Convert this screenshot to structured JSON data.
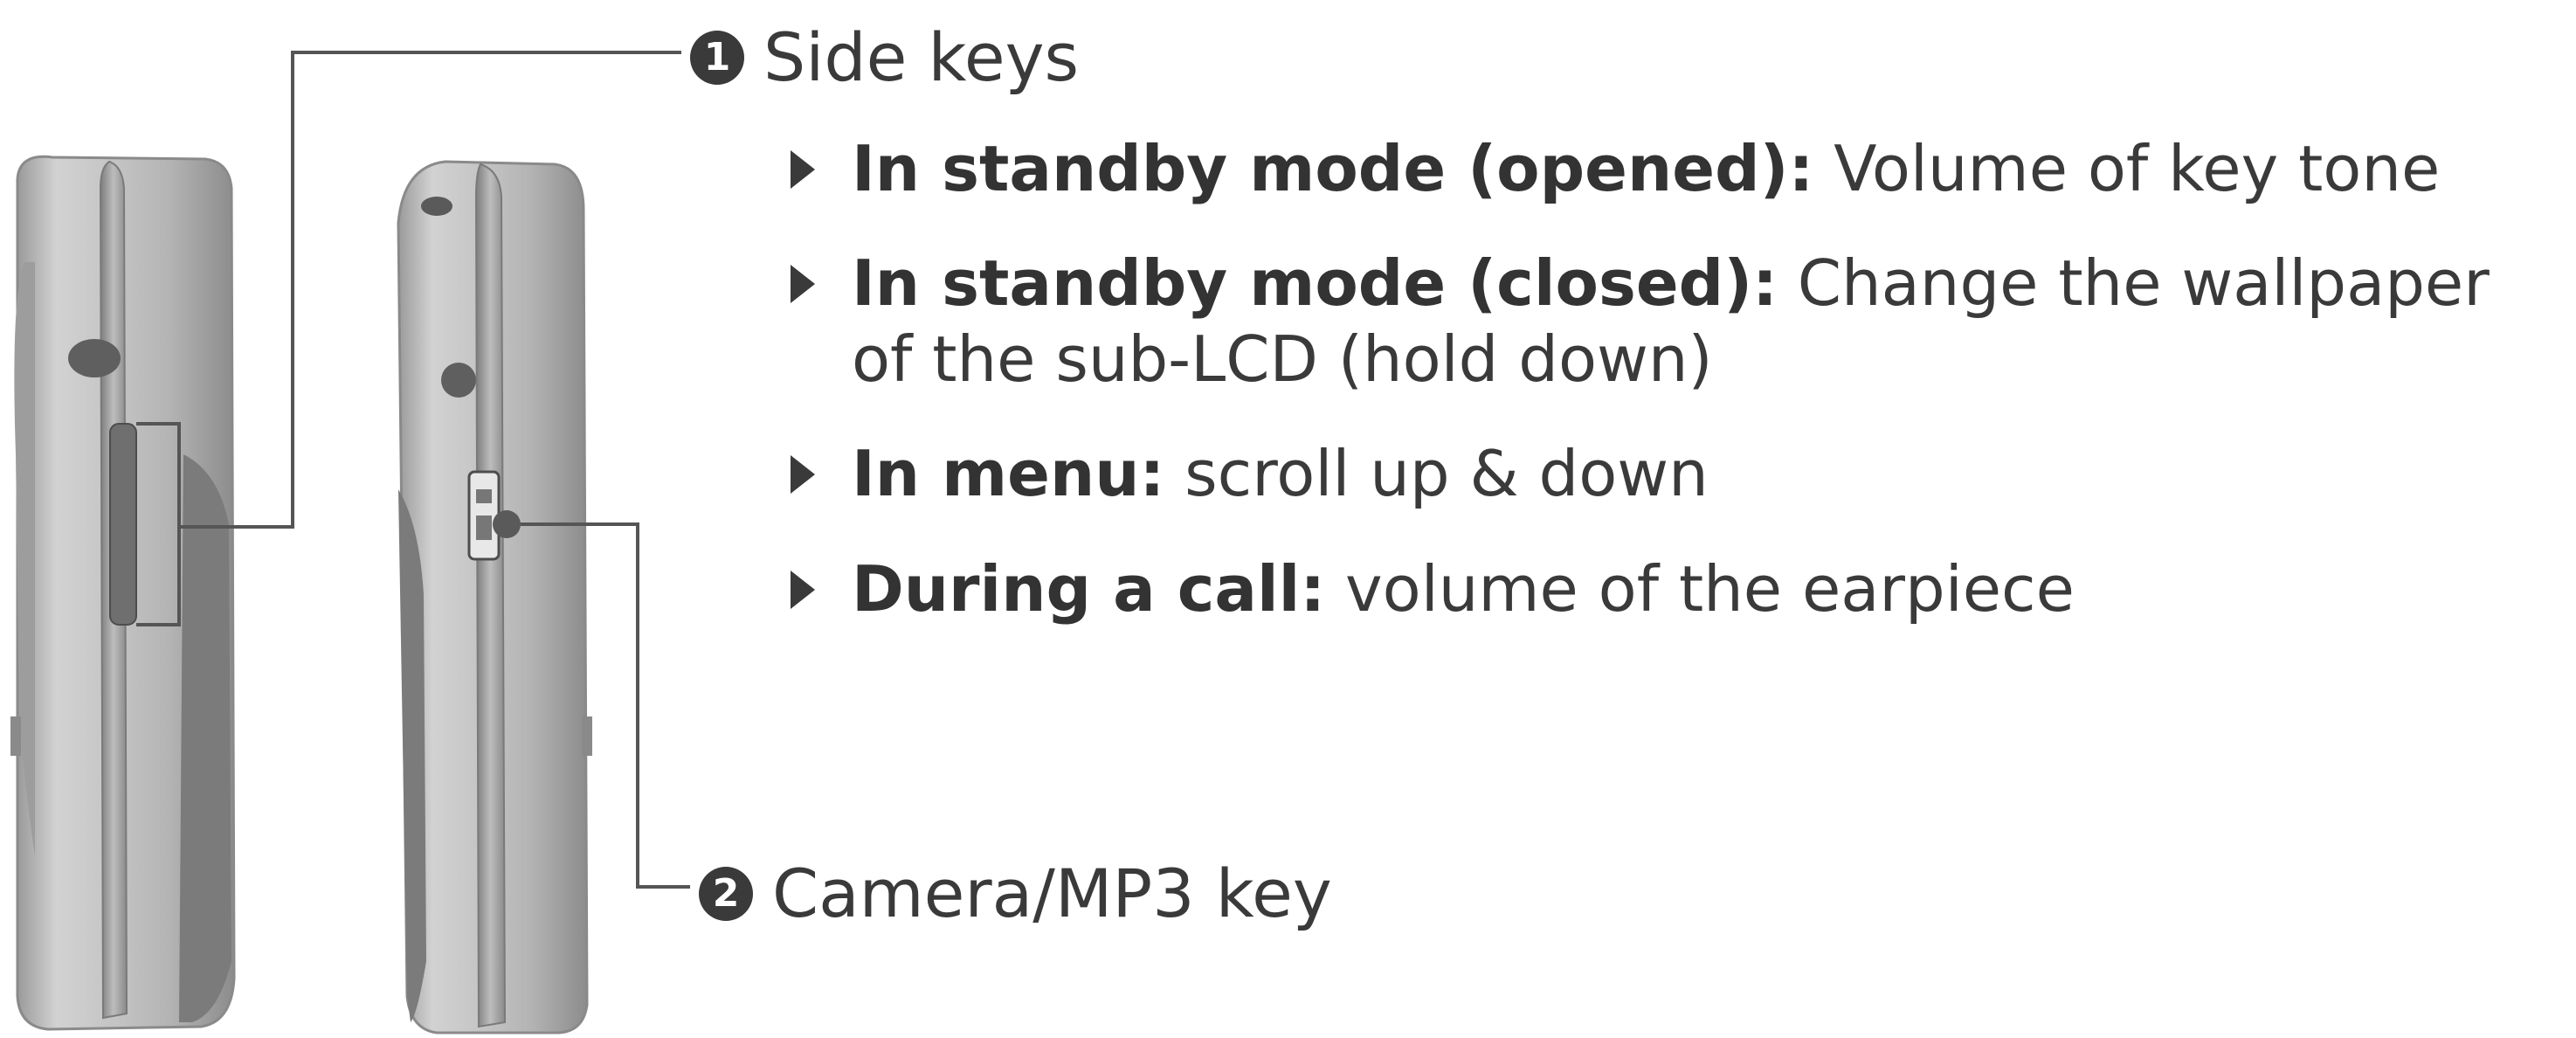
{
  "labels": {
    "side_keys": {
      "number": "1",
      "text": "Side keys"
    },
    "camera_key": {
      "number": "2",
      "text": "Camera/MP3 key"
    }
  },
  "bullets": [
    {
      "lead": "In standby mode (opened):",
      "desc": " Volume of key tone"
    },
    {
      "lead": "In standby mode (closed):",
      "desc": " Change the wallpaper of the sub-LCD (hold down)"
    },
    {
      "lead": "In menu:",
      "desc": " scroll up & down"
    },
    {
      "lead": "During a call:",
      "desc": " volume of the earpiece"
    }
  ],
  "colors": {
    "text": "#3a3a3a",
    "phone_body": "#c2c2c2",
    "phone_dark": "#8a8a8a",
    "leader_line": "#555555"
  },
  "icons": {
    "bullet": "triangle-right-icon",
    "callout": "numbered-circle-icon"
  }
}
